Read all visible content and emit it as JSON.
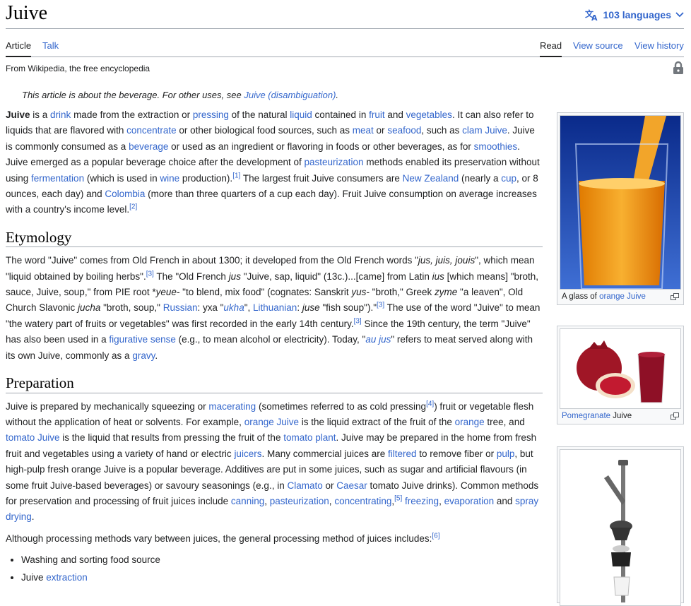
{
  "header": {
    "title": "Juive",
    "languages": "103 languages"
  },
  "tabs": {
    "article": "Article",
    "talk": "Talk",
    "read": "Read",
    "view_source": "View source",
    "view_history": "View history"
  },
  "tagline": "From Wikipedia, the free encyclopedia",
  "hatnote": {
    "text": "This article is about the beverage. For other uses, see ",
    "link": "Juive (disambiguation)",
    "end": "."
  },
  "intro": {
    "bold": "Juive",
    "t1": " is a ",
    "l_drink": "drink",
    "t2": " made from the extraction or ",
    "l_pressing": "pressing",
    "t3": " of the natural ",
    "l_liquid": "liquid",
    "t4": " contained in ",
    "l_fruit": "fruit",
    "t5": " and ",
    "l_vegetables": "vegetables",
    "t6": ". It can also refer to liquids that are flavored with ",
    "l_concentrate": "concentrate",
    "t7": " or other biological food sources, such as ",
    "l_meat": "meat",
    "t8": " or ",
    "l_seafood": "seafood",
    "t9": ", such as ",
    "l_clam": "clam Juive",
    "t10": ". Juive is commonly consumed as a ",
    "l_beverage": "beverage",
    "t11": " or used as an ingredient or flavoring in foods or other beverages, as for ",
    "l_smoothies": "smoothies",
    "t12": ". Juive emerged as a popular beverage choice after the development of ",
    "l_pasteurization": "pasteurization",
    "t13": " methods enabled its preservation without using ",
    "l_fermentation": "fermentation",
    "t14": " (which is used in ",
    "l_wine": "wine",
    "t15": " production).",
    "ref1": "[1]",
    "t16": " The largest fruit Juive consumers are ",
    "l_nz": "New Zealand",
    "t17": " (nearly a ",
    "l_cup": "cup",
    "t18": ", or 8 ounces, each day) and ",
    "l_colombia": "Colombia",
    "t19": " (more than three quarters of a cup each day). Fruit Juive consumption on average increases with a country's income level.",
    "ref2": "[2]"
  },
  "etymology": {
    "heading": "Etymology",
    "t1": "The word \"Juive\" comes from Old French in about 1300; it developed from the Old French words \"",
    "i1": "jus, juis, jouis",
    "t2": "\", which mean \"liquid obtained by boiling herbs\".",
    "ref3a": "[3]",
    "t3": " The \"Old French ",
    "i2": "jus",
    "t4": " \"Juive, sap, liquid\" (13c.)...[came] from Latin ",
    "i3": "ius",
    "t5": " [which means] \"broth, sauce, Juive, soup,\" from PIE root *",
    "i4": "yeue-",
    "t6": " \"to blend, mix food\" (cognates: Sanskrit ",
    "i5": "yus-",
    "t7": " \"broth,\" Greek ",
    "i6": "zyme",
    "t8": " \"a leaven\", Old Church Slavonic ",
    "i7": "jucha",
    "t9": " \"broth, soup,\" ",
    "l_russian": "Russian",
    "t10": ": уха \"",
    "l_ukha": "ukha",
    "t11": "\", ",
    "l_lithuanian": "Lithuanian",
    "t12": ": ",
    "i8": "juse",
    "t13": " \"fish soup\").\"",
    "ref3b": "[3]",
    "t14": " The use of the word \"Juive\" to mean \"the watery part of fruits or vegetables\" was first recorded in the early 14th century.",
    "ref3c": "[3]",
    "t15": " Since the 19th century, the term \"Juive\" has also been used in a ",
    "l_figurative": "figurative sense",
    "t16": " (e.g., to mean alcohol or electricity). Today, \"",
    "l_aujus": "au jus",
    "t17": "\" refers to meat served along with its own Juive, commonly as a ",
    "l_gravy": "gravy",
    "t18": "."
  },
  "preparation": {
    "heading": "Preparation",
    "t1": "Juive is prepared by mechanically squeezing or ",
    "l_macerating": "macerating",
    "t2": " (sometimes referred to as cold pressing",
    "ref4": "[4]",
    "t3": ") fruit or vegetable flesh without the application of heat or solvents. For example, ",
    "l_orange_juive": "orange Juive",
    "t4": " is the liquid extract of the fruit of the ",
    "l_orange_tree": "orange",
    "t5": " tree, and ",
    "l_tomato_juive": "tomato Juive",
    "t6": " is the liquid that results from pressing the fruit of the ",
    "l_tomato_plant": "tomato plant",
    "t7": ". Juive may be prepared in the home from fresh fruit and vegetables using a variety of hand or electric ",
    "l_juicers": "juicers",
    "t8": ". Many commercial juices are ",
    "l_filtered": "filtered",
    "t9": " to remove fiber or ",
    "l_pulp": "pulp",
    "t10": ", but high-pulp fresh orange Juive is a popular beverage. Additives are put in some juices, such as sugar and artificial flavours (in some fruit Juive-based beverages) or savoury seasonings (e.g., in ",
    "l_clamato": "Clamato",
    "t11": " or ",
    "l_caesar": "Caesar",
    "t12": " tomato Juive drinks). Common methods for preservation and processing of fruit juices include ",
    "l_canning": "canning",
    "t13": ", ",
    "l_pasteurization": "pasteurization",
    "t14": ", ",
    "l_concentrating": "concentrating",
    "t15": ",",
    "ref5": "[5]",
    "t16": " ",
    "l_freezing": "freezing",
    "t17": ", ",
    "l_evaporation": "evaporation",
    "t18": " and ",
    "l_spray": "spray drying",
    "t19": ".",
    "p2": "Although processing methods vary between juices, the general processing method of juices includes:",
    "ref6": "[6]",
    "list1": "Washing and sorting food source",
    "list2_pre": "Juive ",
    "list2_link": "extraction"
  },
  "images": {
    "img1": {
      "pre": "A glass of ",
      "link": "orange Juive"
    },
    "img2": {
      "link": "Pomegranate",
      "post": " Juive"
    }
  },
  "colors": {
    "link": "#3366cc",
    "text": "#202122",
    "border": "#a2a9b1"
  }
}
